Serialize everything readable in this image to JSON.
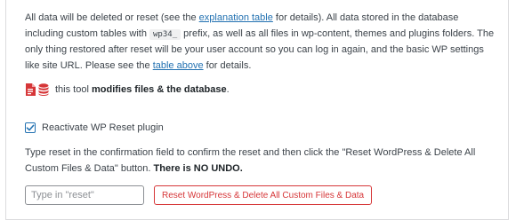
{
  "colors": {
    "text": "#3c434a",
    "link": "#2271b1",
    "danger": "#d63638",
    "border": "#dcdcde"
  },
  "intro": {
    "text_1": "All data will be deleted or reset (see the ",
    "link_1": "explanation table",
    "text_2": " for details). All data stored in the database including custom tables with ",
    "prefix_code": "wp34_",
    "text_3": " prefix, as well as all files in wp-content, themes and plugins folders. The only thing restored after reset will be your user account so you can log in again, and the basic WP settings like site URL. Please see the ",
    "link_2": "table above",
    "text_4": " for details."
  },
  "warning": {
    "icons": [
      "file-icon",
      "database-icon"
    ],
    "text": "this tool ",
    "bold": "modifies files & the database",
    "end": "."
  },
  "reactivate": {
    "checked": true,
    "label": "Reactivate WP Reset plugin"
  },
  "instructions": {
    "text": "Type reset in the confirmation field to confirm the reset and then click the \"Reset WordPress & Delete All Custom Files & Data\" button. ",
    "bold": "There is NO UNDO."
  },
  "confirm": {
    "placeholder": "Type in \"reset\"",
    "value": ""
  },
  "reset_button": {
    "label": "Reset WordPress & Delete All Custom Files & Data"
  }
}
